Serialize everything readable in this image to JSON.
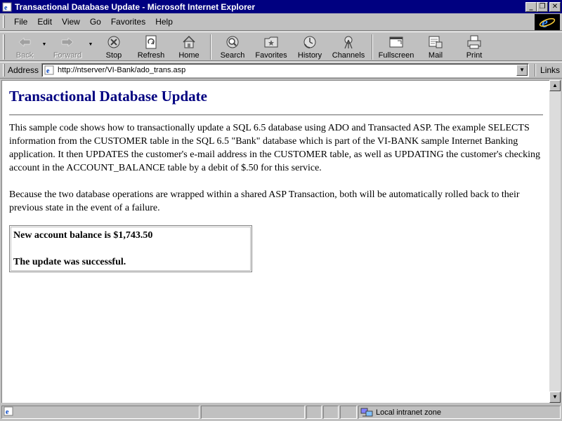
{
  "window": {
    "title": "Transactional Database Update - Microsoft Internet Explorer",
    "minimize": "_",
    "restore": "❐",
    "close": "✕"
  },
  "menu": {
    "items": [
      "File",
      "Edit",
      "View",
      "Go",
      "Favorites",
      "Help"
    ]
  },
  "toolbar": {
    "buttons": [
      {
        "label": "Back",
        "icon": "back-arrow-icon",
        "enabled": false
      },
      {
        "label": "Forward",
        "icon": "forward-arrow-icon",
        "enabled": false
      },
      {
        "label": "Stop",
        "icon": "stop-icon",
        "enabled": true
      },
      {
        "label": "Refresh",
        "icon": "refresh-icon",
        "enabled": true
      },
      {
        "label": "Home",
        "icon": "home-icon",
        "enabled": true
      },
      {
        "label": "Search",
        "icon": "search-icon",
        "enabled": true
      },
      {
        "label": "Favorites",
        "icon": "favorites-icon",
        "enabled": true
      },
      {
        "label": "History",
        "icon": "history-icon",
        "enabled": true
      },
      {
        "label": "Channels",
        "icon": "channels-icon",
        "enabled": true
      },
      {
        "label": "Fullscreen",
        "icon": "fullscreen-icon",
        "enabled": true
      },
      {
        "label": "Mail",
        "icon": "mail-icon",
        "enabled": true
      },
      {
        "label": "Print",
        "icon": "print-icon",
        "enabled": true
      }
    ]
  },
  "address": {
    "label": "Address",
    "url": "http://ntserver/VI-Bank/ado_trans.asp",
    "links_label": "Links"
  },
  "page": {
    "heading": "Transactional Database Update",
    "paragraph1": "This sample code shows how to transactionally update a SQL 6.5 database using ADO and Transacted ASP. The example SELECTS information from the CUSTOMER table in the SQL 6.5 \"Bank\" database which is part of the VI-BANK sample Internet Banking application. It then UPDATES the customer's e-mail address in the CUSTOMER table, as well as UPDATING the customer's checking account in the ACCOUNT_BALANCE table by a debit of $.50 for this service.",
    "paragraph2": "Because the two database operations are wrapped within a shared ASP Transaction, both will be automatically rolled back to their previous state in the event of a failure.",
    "result_line1": "New account balance is $1,743.50",
    "result_line2": "The update was successful."
  },
  "status": {
    "zone": "Local intranet zone"
  },
  "colors": {
    "titlebar": "#000080",
    "heading": "#000080",
    "chrome": "#c0c0c0"
  }
}
